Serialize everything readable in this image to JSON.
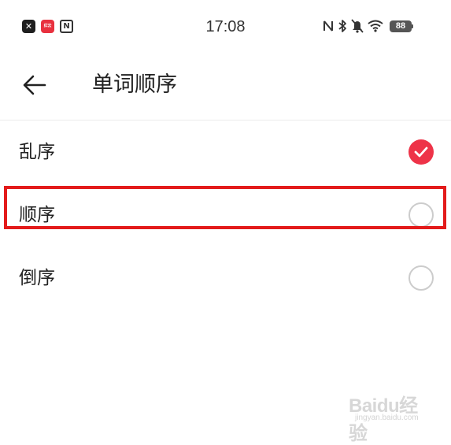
{
  "status_bar": {
    "time": "17:08",
    "battery_level": "88",
    "left_icons": [
      "x-app-icon",
      "red-app-icon",
      "nfc-app-icon"
    ],
    "right_icons": [
      "nfc-icon",
      "bluetooth-icon",
      "mute-icon",
      "wifi-icon",
      "battery-icon"
    ],
    "red_app_text": "红云"
  },
  "header": {
    "title": "单词顺序",
    "back_icon": "arrow-left-icon"
  },
  "options": [
    {
      "label": "乱序",
      "selected": true
    },
    {
      "label": "顺序",
      "selected": false
    },
    {
      "label": "倒序",
      "selected": false
    }
  ],
  "colors": {
    "accent": "#ee3348",
    "highlight": "#e31b1b",
    "radio_border": "#cccccc"
  },
  "watermark": {
    "logo": "Baidu经验",
    "sub": "jingyan.baidu.com"
  }
}
